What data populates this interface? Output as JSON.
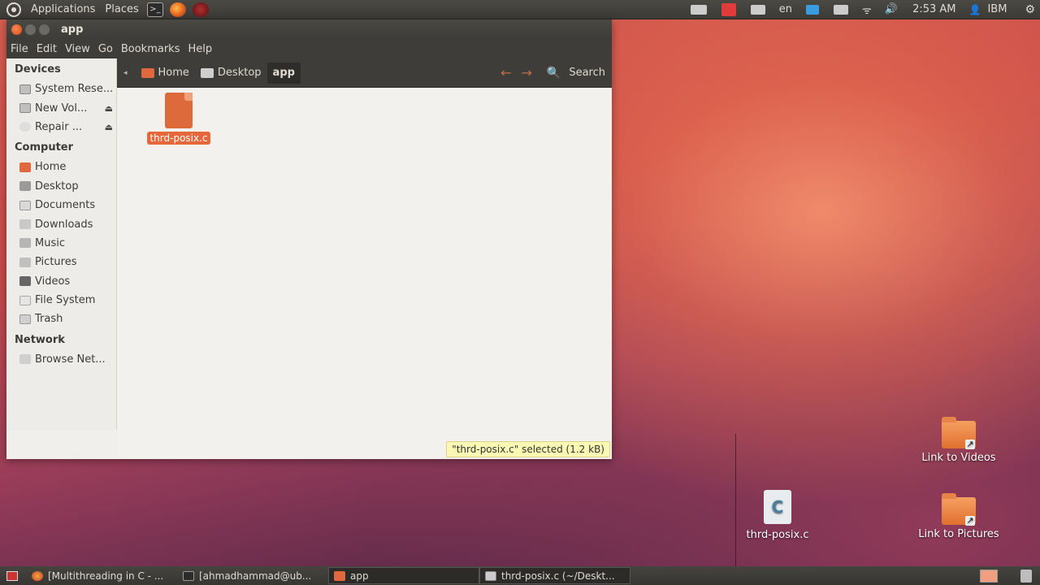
{
  "top_panel": {
    "menus": [
      "Applications",
      "Places"
    ],
    "keyboard_layout": "en",
    "clock": "2:53 AM",
    "user": "IBM"
  },
  "window": {
    "title": "app",
    "menubar": [
      "File",
      "Edit",
      "View",
      "Go",
      "Bookmarks",
      "Help"
    ],
    "breadcrumbs": [
      "Home",
      "Desktop",
      "app"
    ],
    "search_label": "Search",
    "sidebar": {
      "devices_heading": "Devices",
      "devices": [
        "System Rese...",
        "New Vol...",
        "Repair ..."
      ],
      "computer_heading": "Computer",
      "computer": [
        "Home",
        "Desktop",
        "Documents",
        "Downloads",
        "Music",
        "Pictures",
        "Videos",
        "File System",
        "Trash"
      ],
      "network_heading": "Network",
      "network": [
        "Browse Net..."
      ]
    },
    "files": [
      {
        "name": "thrd-posix.c",
        "selected": true
      }
    ],
    "status": "\"thrd-posix.c\" selected (1.2 kB)"
  },
  "desktop_icons": {
    "videos_link": "Link to Videos",
    "c_file": "thrd-posix.c",
    "pictures_link": "Link to Pictures"
  },
  "taskbar": [
    {
      "label": "[Multithreading in C - ...",
      "icon": "firefox-icon"
    },
    {
      "label": "[ahmadhammad@ub...",
      "icon": "terminal-icon"
    },
    {
      "label": "app",
      "icon": "folder-icon"
    },
    {
      "label": "thrd-posix.c (~/Deskt...",
      "icon": "text-editor-icon"
    }
  ],
  "colors": {
    "accent": "#e6683a",
    "panel": "#3e3d39",
    "status_bg": "#fbf8b3"
  }
}
